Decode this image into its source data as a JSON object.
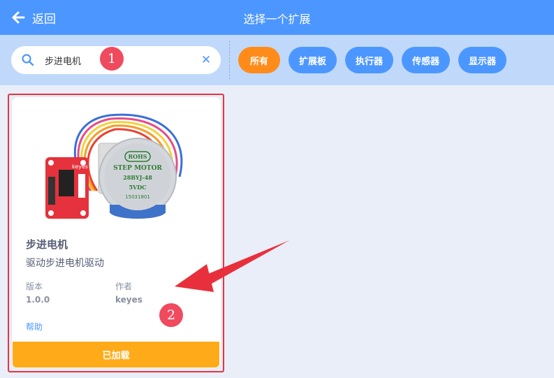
{
  "header": {
    "back_label": "返回",
    "title": "选择一个扩展"
  },
  "search": {
    "value": "步进电机",
    "placeholder": ""
  },
  "filters": [
    {
      "label": "所有",
      "active": true
    },
    {
      "label": "扩展板",
      "active": false
    },
    {
      "label": "执行器",
      "active": false
    },
    {
      "label": "传感器",
      "active": false
    },
    {
      "label": "显示器",
      "active": false
    }
  ],
  "annotations": {
    "step1": "1",
    "step2": "2"
  },
  "extension_card": {
    "title": "步进电机",
    "description": "驱动步进电机驱动",
    "version_label": "版本",
    "version_value": "1.0.0",
    "author_label": "作者",
    "author_value": "keyes",
    "help_label": "帮助",
    "status_button": "已加载",
    "image": {
      "board_label": "keyes",
      "motor_line1": "ROHS",
      "motor_line2": "STEP MOTOR",
      "motor_line3": "28BYJ-48",
      "motor_line4": "5VDC",
      "motor_line5": "15031801"
    }
  },
  "colors": {
    "topbar": "#4c97ff",
    "filterbar": "#c0d9fb",
    "active_chip": "#ff8c1a",
    "chip": "#4c97ff",
    "loaded_button": "#ffab19",
    "highlight": "#e83340",
    "badge": "#f04a5e"
  }
}
